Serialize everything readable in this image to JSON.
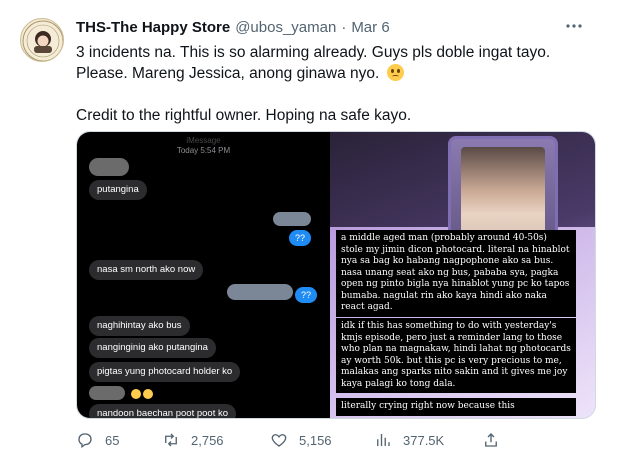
{
  "author": {
    "name": "THS-The Happy Store",
    "handle": "@ubos_yaman",
    "separator": "·",
    "date": "Mar 6",
    "avatar_icon": "store-logo-icon"
  },
  "tweet": {
    "line1": "3 incidents na. This is so alarming already. Guys pls doble ingat tayo.",
    "line2": "Please. Mareng Jessica, anong ginawa nyo.",
    "line3": "Credit to the rightful owner. Hoping na safe kayo."
  },
  "chat": {
    "header_top": "iMessage",
    "header_time": "Today 5:54 PM",
    "messages": [
      "putangina",
      "??",
      "nasa sm north ako now",
      "??",
      "naghihintay ako bus",
      "nanginginig ako putangina",
      "pigtas yung photocard holder ko",
      "nandoon baechan poot poot ko"
    ]
  },
  "photo": {
    "caption1": "a middle aged man (probably around 40-50s) stole my jimin dicon photocard. literal na hinablot nya sa bag ko habang nagpophone ako sa bus. nasa unang seat ako ng bus, pababa sya, pagka open ng pinto bigla nya hinablot yung pc ko tapos bumaba. nagulat rin ako kaya hindi ako naka react agad.",
    "caption2": "idk if this has something to do with yesterday's kmjs episode, pero just a reminder lang to those who plan na magnakaw, hindi lahat ng photocards ay worth 50k. but this pc is very precious to me, malakas ang sparks nito sakin and it gives me joy kaya palagi ko tong dala.",
    "caption3": "literally crying right now because this"
  },
  "actions": {
    "replies": "65",
    "retweets": "2,756",
    "likes": "5,156",
    "views": "377.5K"
  },
  "colors": {
    "text": "#0f1419",
    "secondary": "#536471",
    "imessage_blue": "#1f8cf5"
  }
}
